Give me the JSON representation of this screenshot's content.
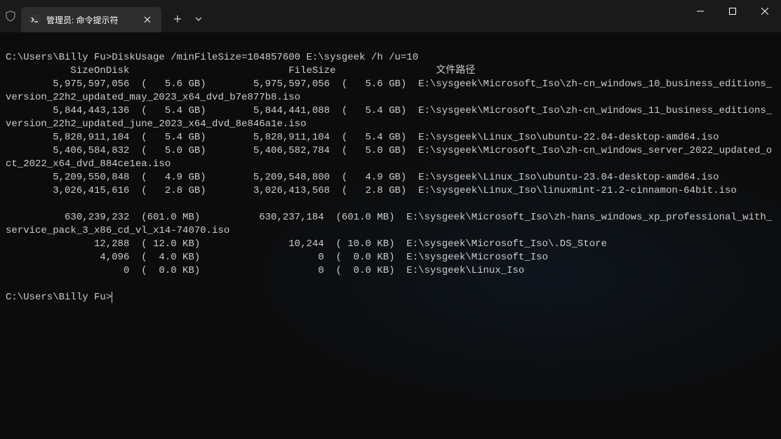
{
  "window": {
    "tab_title": "管理员: 命令提示符"
  },
  "terminal": {
    "prompt1": "C:\\Users\\Billy Fu>",
    "command": "DiskUsage /minFileSize=104857600 E:\\sysgeek /h /u=10",
    "header": {
      "col1": "SizeOnDisk",
      "col2": "FileSize",
      "col3": "文件路径"
    },
    "rows": [
      {
        "size_on_disk": "5,975,597,056",
        "size_on_disk_h": "(   5.6 GB)",
        "file_size": "5,975,597,056",
        "file_size_h": "(   5.6 GB)",
        "path": "E:\\sysgeek\\Microsoft_Iso\\zh-cn_windows_10_business_editions_version_22h2_updated_may_2023_x64_dvd_b7e877b8.iso"
      },
      {
        "size_on_disk": "5,844,443,136",
        "size_on_disk_h": "(   5.4 GB)",
        "file_size": "5,844,441,088",
        "file_size_h": "(   5.4 GB)",
        "path": "E:\\sysgeek\\Microsoft_Iso\\zh-cn_windows_11_business_editions_version_22h2_updated_june_2023_x64_dvd_8e846a1e.iso"
      },
      {
        "size_on_disk": "5,828,911,104",
        "size_on_disk_h": "(   5.4 GB)",
        "file_size": "5,828,911,104",
        "file_size_h": "(   5.4 GB)",
        "path": "E:\\sysgeek\\Linux_Iso\\ubuntu-22.04-desktop-amd64.iso"
      },
      {
        "size_on_disk": "5,406,584,832",
        "size_on_disk_h": "(   5.0 GB)",
        "file_size": "5,406,582,784",
        "file_size_h": "(   5.0 GB)",
        "path": "E:\\sysgeek\\Microsoft_Iso\\zh-cn_windows_server_2022_updated_oct_2022_x64_dvd_884ce1ea.iso"
      },
      {
        "size_on_disk": "5,209,550,848",
        "size_on_disk_h": "(   4.9 GB)",
        "file_size": "5,209,548,800",
        "file_size_h": "(   4.9 GB)",
        "path": "E:\\sysgeek\\Linux_Iso\\ubuntu-23.04-desktop-amd64.iso"
      },
      {
        "size_on_disk": "3,026,415,616",
        "size_on_disk_h": "(   2.8 GB)",
        "file_size": "3,026,413,568",
        "file_size_h": "(   2.8 GB)",
        "path": "E:\\sysgeek\\Linux_Iso\\linuxmint-21.2-cinnamon-64bit.iso"
      },
      {
        "size_on_disk": "630,239,232",
        "size_on_disk_h": "(601.0 MB)",
        "file_size": "630,237,184",
        "file_size_h": "(601.0 MB)",
        "path": "E:\\sysgeek\\Microsoft_Iso\\zh-hans_windows_xp_professional_with_service_pack_3_x86_cd_vl_x14-74070.iso"
      },
      {
        "size_on_disk": "12,288",
        "size_on_disk_h": "( 12.0 KB)",
        "file_size": "10,244",
        "file_size_h": "( 10.0 KB)",
        "path": "E:\\sysgeek\\Microsoft_Iso\\.DS_Store"
      },
      {
        "size_on_disk": "4,096",
        "size_on_disk_h": "(  4.0 KB)",
        "file_size": "0",
        "file_size_h": "(  0.0 KB)",
        "path": "E:\\sysgeek\\Microsoft_Iso"
      },
      {
        "size_on_disk": "0",
        "size_on_disk_h": "(  0.0 KB)",
        "file_size": "0",
        "file_size_h": "(  0.0 KB)",
        "path": "E:\\sysgeek\\Linux_Iso"
      }
    ],
    "prompt2": "C:\\Users\\Billy Fu>"
  }
}
